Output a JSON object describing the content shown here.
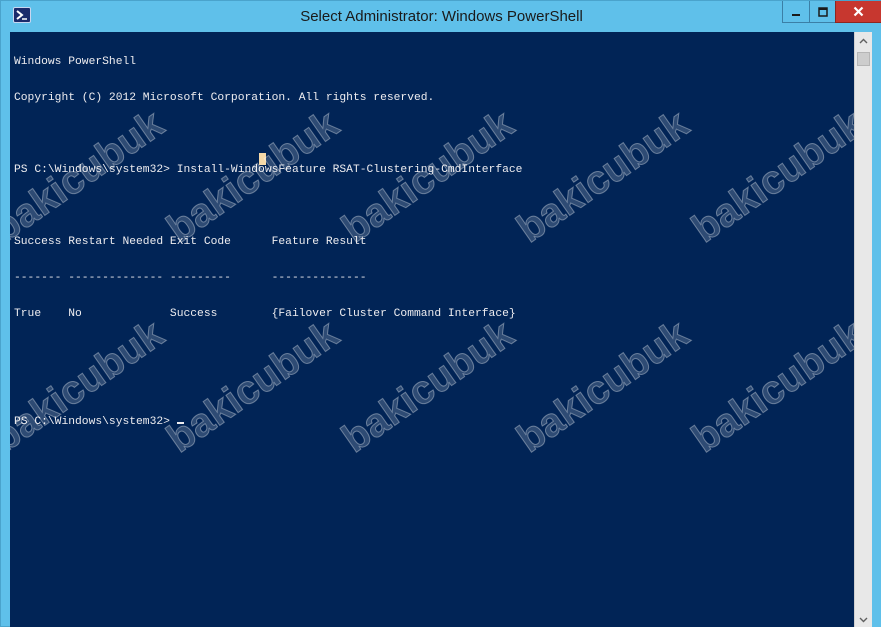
{
  "window": {
    "title": "Select Administrator: Windows PowerShell",
    "icon": "powershell-icon",
    "accent": "#5fc0ea",
    "console_bg": "#012456",
    "console_fg": "#eeedf0"
  },
  "caption": {
    "minimize_icon": "minimize-icon",
    "maximize_icon": "maximize-icon",
    "close_icon": "close-icon"
  },
  "console": {
    "lines": [
      "Windows PowerShell",
      "Copyright (C) 2012 Microsoft Corporation. All rights reserved.",
      "",
      "PS C:\\Windows\\system32> Install-WindowsFeature RSAT-Clustering-CmdInterface",
      "",
      "Success Restart Needed Exit Code      Feature Result",
      "------- -------------- ---------      --------------",
      "True    No             Success        {Failover Cluster Command Interface}",
      "",
      "",
      "PS C:\\Windows\\system32> "
    ]
  },
  "watermark": {
    "text": "bakicubuk"
  }
}
